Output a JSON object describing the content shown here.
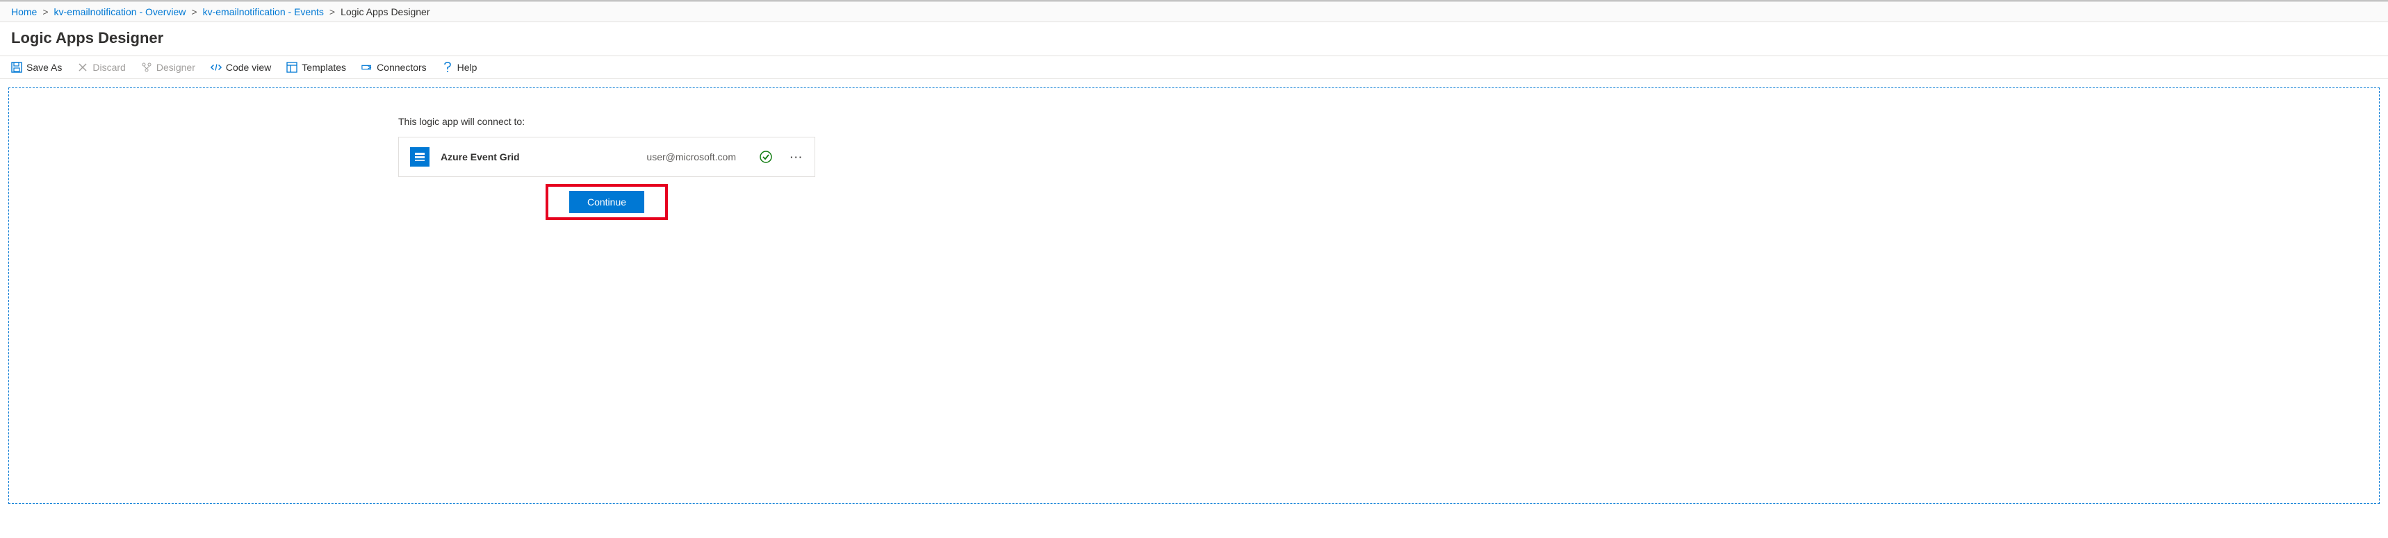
{
  "breadcrumb": {
    "items": [
      {
        "label": "Home",
        "link": true
      },
      {
        "label": "kv-emailnotification - Overview",
        "link": true
      },
      {
        "label": "kv-emailnotification - Events",
        "link": true
      },
      {
        "label": "Logic Apps Designer",
        "link": false
      }
    ]
  },
  "page_title": "Logic Apps Designer",
  "toolbar": {
    "save_as": "Save As",
    "discard": "Discard",
    "designer": "Designer",
    "code_view": "Code view",
    "templates": "Templates",
    "connectors": "Connectors",
    "help": "Help"
  },
  "designer": {
    "connect_label": "This logic app will connect to:",
    "connection": {
      "service": "Azure Event Grid",
      "user": "user@microsoft.com",
      "status": "ok"
    },
    "continue_label": "Continue"
  },
  "colors": {
    "accent": "#0078d4",
    "highlight": "#e6001f",
    "success": "#107c10"
  }
}
